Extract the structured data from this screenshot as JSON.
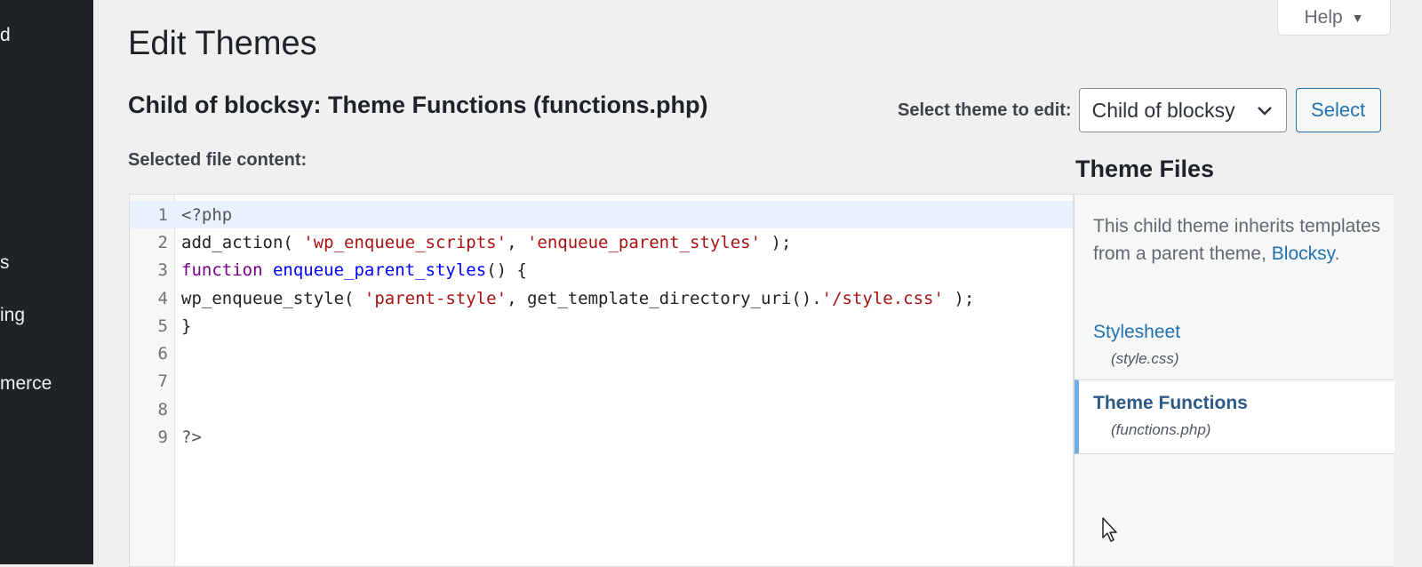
{
  "sidebar": {
    "items": [
      {
        "label": "d"
      },
      {
        "label": "s"
      },
      {
        "label": "ing"
      },
      {
        "label": "merce"
      }
    ]
  },
  "header": {
    "help_label": "Help",
    "page_title": "Edit Themes",
    "file_title": "Child of blocksy: Theme Functions (functions.php)",
    "file_content_label": "Selected file content:"
  },
  "theme_selector": {
    "label": "Select theme to edit:",
    "selected": "Child of blocksy",
    "button_label": "Select"
  },
  "editor": {
    "lines": [
      {
        "number": "1"
      },
      {
        "number": "2"
      },
      {
        "number": "3"
      },
      {
        "number": "4"
      },
      {
        "number": "5"
      },
      {
        "number": "6"
      },
      {
        "number": "7"
      },
      {
        "number": "8"
      },
      {
        "number": "9"
      }
    ],
    "code": {
      "l1": "<?php",
      "l2a": "add_action( ",
      "l2b": "'wp_enqueue_scripts'",
      "l2c": ", ",
      "l2d": "'enqueue_parent_styles'",
      "l2e": " );",
      "l3a": "function",
      "l3b": " ",
      "l3c": "enqueue_parent_styles",
      "l3d": "() {",
      "l4a": "wp_enqueue_style( ",
      "l4b": "'parent-style'",
      "l4c": ", get_template_directory_uri().",
      "l4d": "'/style.css'",
      "l4e": " );",
      "l5": "}",
      "l9": "?>"
    }
  },
  "theme_files": {
    "title": "Theme Files",
    "description_prefix": "This child theme inherits templates from a parent theme, ",
    "parent_link": "Blocksy",
    "description_suffix": ".",
    "files": [
      {
        "name": "Stylesheet",
        "filename": "(style.css)",
        "selected": false
      },
      {
        "name": "Theme Functions",
        "filename": "(functions.php)",
        "selected": true
      }
    ]
  },
  "colors": {
    "sidebar_bg": "#1d2327",
    "accent": "#2271b1",
    "selected_border": "#72aee6"
  }
}
